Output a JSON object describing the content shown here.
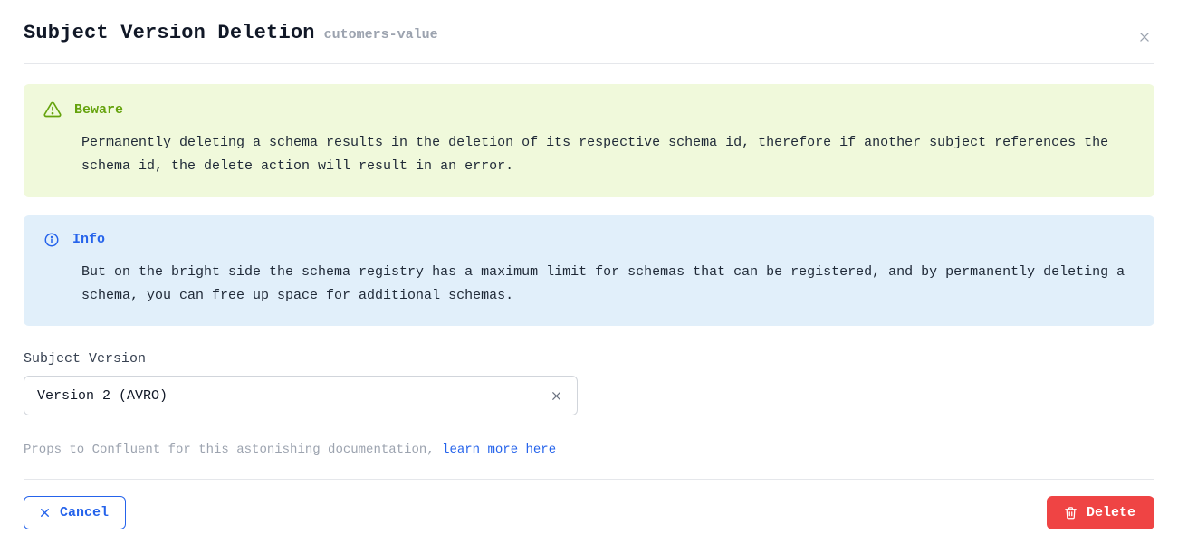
{
  "header": {
    "title": "Subject Version Deletion",
    "subject": "cutomers-value"
  },
  "alerts": {
    "beware": {
      "title": "Beware",
      "body": "Permanently deleting a schema results in the deletion of its respective schema id, therefore if another subject references the schema id, the delete action will result in an error."
    },
    "info": {
      "title": "Info",
      "body": "But on the bright side the schema registry has a maximum limit for schemas that can be registered, and by permanently deleting a schema, you can free up space for additional schemas."
    }
  },
  "field": {
    "label": "Subject Version",
    "value": "Version 2 (AVRO)"
  },
  "footnote": {
    "prefix": "Props to Confluent for this astonishing documentation, ",
    "link_text": "learn more here"
  },
  "buttons": {
    "cancel": "Cancel",
    "delete": "Delete"
  }
}
